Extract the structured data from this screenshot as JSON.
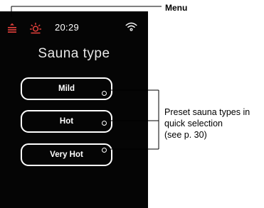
{
  "status_bar": {
    "time": "20:29",
    "icons": {
      "menu": "menu-icon",
      "sauna": "sauna-heater-icon",
      "wifi": "wifi-icon"
    }
  },
  "screen": {
    "title": "Sauna type",
    "presets": [
      {
        "label": "Mild"
      },
      {
        "label": "Hot"
      },
      {
        "label": "Very Hot"
      }
    ]
  },
  "callouts": {
    "menu": "Menu",
    "presets": [
      "Preset sauna types in",
      "quick selection",
      "(see p. 30)"
    ]
  },
  "colors": {
    "screen_background": "#050505",
    "accent_red": "#e8413c",
    "foreground": "#ffffff"
  }
}
